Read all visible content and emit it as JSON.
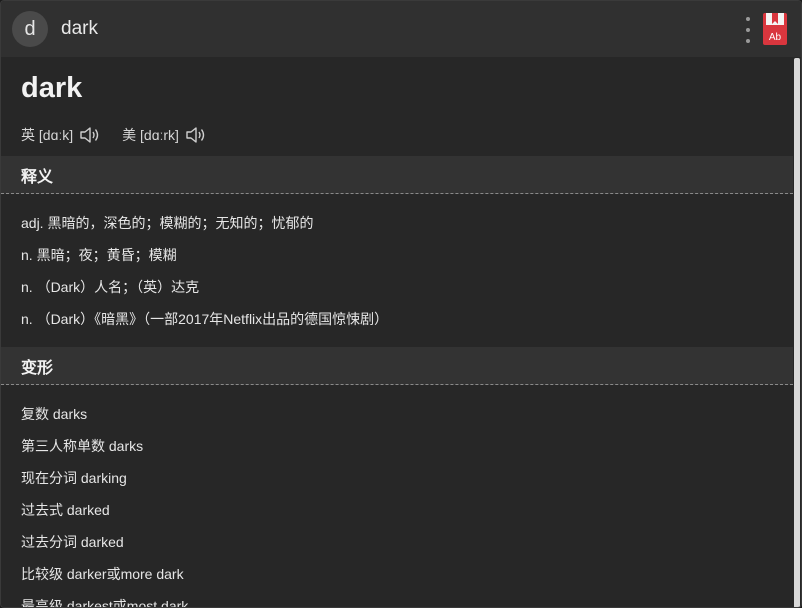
{
  "search": {
    "avatar_letter": "d",
    "query": "dark"
  },
  "entry": {
    "word": "dark",
    "phonetics": [
      {
        "label": "英 [dɑːk]",
        "audio_icon": "speaker-icon"
      },
      {
        "label": "美 [dɑːrk]",
        "audio_icon": "speaker-icon"
      }
    ]
  },
  "sections": {
    "definitions_title": "释义",
    "definitions": [
      "adj. 黑暗的，深色的；模糊的；无知的；忧郁的",
      "n. 黑暗；夜；黄昏；模糊",
      "n. （Dark）人名；（英）达克",
      "n. （Dark）《暗黑》（一部2017年Netflix出品的德国惊悚剧）"
    ],
    "forms_title": "变形",
    "forms": [
      "复数 darks",
      "第三人称单数 darks",
      "现在分词 darking",
      "过去式 darked",
      "过去分词 darked",
      "比较级 darker或more dark",
      "最高级 darkest或most dark"
    ]
  },
  "colors": {
    "background": "#272727",
    "header_bg": "#303030",
    "section_bg": "#333333",
    "dict_icon_red": "#d9363e"
  }
}
